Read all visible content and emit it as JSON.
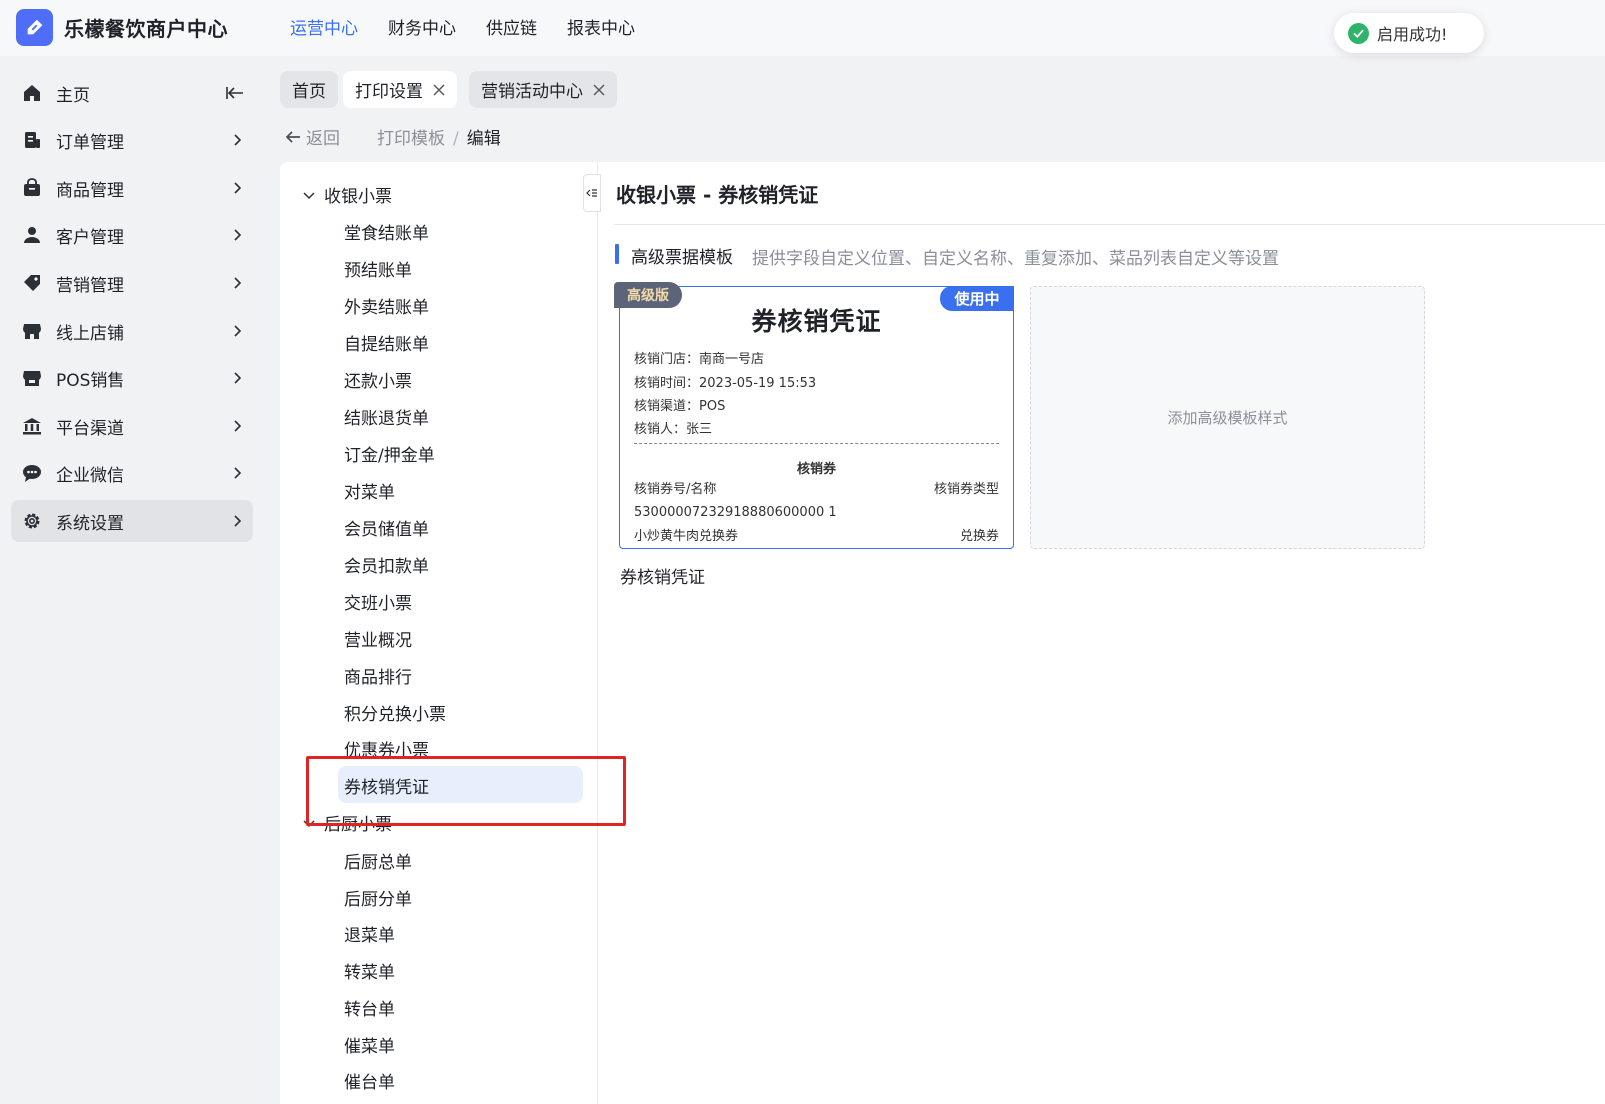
{
  "brand": {
    "name": "乐檬餐饮商户中心"
  },
  "topnav": [
    {
      "label": "运营中心"
    },
    {
      "label": "财务中心"
    },
    {
      "label": "供应链"
    },
    {
      "label": "报表中心"
    }
  ],
  "toast": {
    "message": "启用成功!"
  },
  "sidebar": {
    "items": [
      {
        "label": "主页",
        "icon": "home-icon"
      },
      {
        "label": "订单管理",
        "icon": "order-icon"
      },
      {
        "label": "商品管理",
        "icon": "bag-icon"
      },
      {
        "label": "客户管理",
        "icon": "user-icon"
      },
      {
        "label": "营销管理",
        "icon": "tag-icon"
      },
      {
        "label": "线上店铺",
        "icon": "store-icon"
      },
      {
        "label": "POS销售",
        "icon": "pos-icon"
      },
      {
        "label": "平台渠道",
        "icon": "bank-icon"
      },
      {
        "label": "企业微信",
        "icon": "chat-icon"
      },
      {
        "label": "系统设置",
        "icon": "gear-icon"
      }
    ]
  },
  "tabs": [
    {
      "label": "首页"
    },
    {
      "label": "打印设置"
    },
    {
      "label": "营销活动中心"
    }
  ],
  "breadcrumb": {
    "back": "返回",
    "parent": "打印模板",
    "sep": "/",
    "current": "编辑"
  },
  "tree": {
    "group1": {
      "label": "收银小票",
      "items": [
        "堂食结账单",
        "预结账单",
        "外卖结账单",
        "自提结账单",
        "还款小票",
        "结账退货单",
        "订金/押金单",
        "对菜单",
        "会员储值单",
        "会员扣款单",
        "交班小票",
        "营业概况",
        "商品排行",
        "积分兑换小票",
        "优惠券小票",
        "券核销凭证"
      ]
    },
    "group2": {
      "label": "后厨小票",
      "items": [
        "后厨总单",
        "后厨分单",
        "退菜单",
        "转菜单",
        "转台单",
        "催菜单",
        "催台单"
      ]
    }
  },
  "content": {
    "title": "收银小票 - 券核销凭证",
    "section_title": "高级票据模板",
    "section_desc": "提供字段自定义位置、自定义名称、重复添加、菜品列表自定义等设置",
    "card": {
      "badge_adv": "高级版",
      "badge_use": "使用中",
      "title": "券核销凭证",
      "lines": [
        "核销门店：南商一号店",
        "核销时间：2023-05-19 15:53",
        "核销渠道：POS",
        "核销人：张三"
      ],
      "section": "核销券",
      "col_left": "核销券号/名称",
      "col_right": "核销券类型",
      "coupon_no": "53000007232918880600000 1",
      "coupon_name": "小炒黄牛肉兑换券",
      "coupon_type": "兑换券"
    },
    "caption": "券核销凭证",
    "add_label": "添加高级模板样式"
  }
}
